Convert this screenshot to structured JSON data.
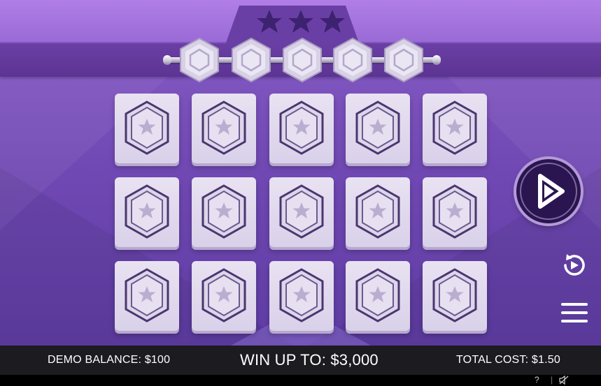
{
  "game": {
    "stars_count": 3,
    "meter_gems": 5,
    "grid_rows": 3,
    "grid_cols": 5
  },
  "icons": {
    "star": "star-icon",
    "gem": "hexagon-gem-icon",
    "tile_symbol": "hexagon-star-icon",
    "play": "play-icon",
    "autoplay": "autoplay-icon",
    "menu": "hamburger-menu-icon",
    "mute": "speaker-muted-icon"
  },
  "footer": {
    "balance": "DEMO BALANCE: $100",
    "win_up_to": "WIN UP TO: $3,000",
    "total_cost": "TOTAL COST: $1.50"
  },
  "subbar": {
    "help": "?",
    "separator": "|"
  },
  "colors": {
    "background": "#7048b3",
    "header": "#5c3493",
    "tile": "#e2dbef",
    "tile_symbol": "#4a3670",
    "play_button": "#2b1550",
    "footer": "#1c1b20"
  }
}
